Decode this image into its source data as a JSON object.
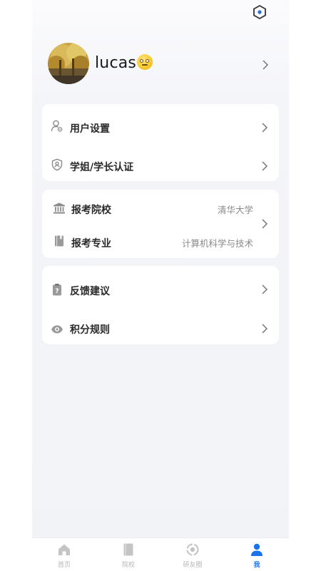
{
  "profile": {
    "username": "lucas",
    "emoji": "eye-roll-emoji"
  },
  "group1": [
    {
      "label": "用户设置",
      "icon": "user-settings-icon"
    },
    {
      "label": "学姐/学长认证",
      "icon": "shield-user-icon"
    }
  ],
  "group2": [
    {
      "label": "报考院校",
      "value": "清华大学",
      "icon": "institution-icon"
    },
    {
      "label": "报考专业",
      "value": "计算机科学与技术",
      "icon": "book-icon"
    }
  ],
  "group3": [
    {
      "label": "反馈建议",
      "icon": "feedback-clipboard-icon"
    },
    {
      "label": "积分规则",
      "icon": "eye-icon"
    }
  ],
  "tabs": [
    {
      "label": "首页",
      "icon": "home-icon"
    },
    {
      "label": "院校",
      "icon": "school-book-icon"
    },
    {
      "label": "研友圈",
      "icon": "circle-icon"
    },
    {
      "label": "我",
      "icon": "person-icon",
      "active": true
    }
  ],
  "colors": {
    "accent": "#1a73e8",
    "icon_gray": "#9a9a9a",
    "inactive_tab": "#c4c4c4"
  }
}
